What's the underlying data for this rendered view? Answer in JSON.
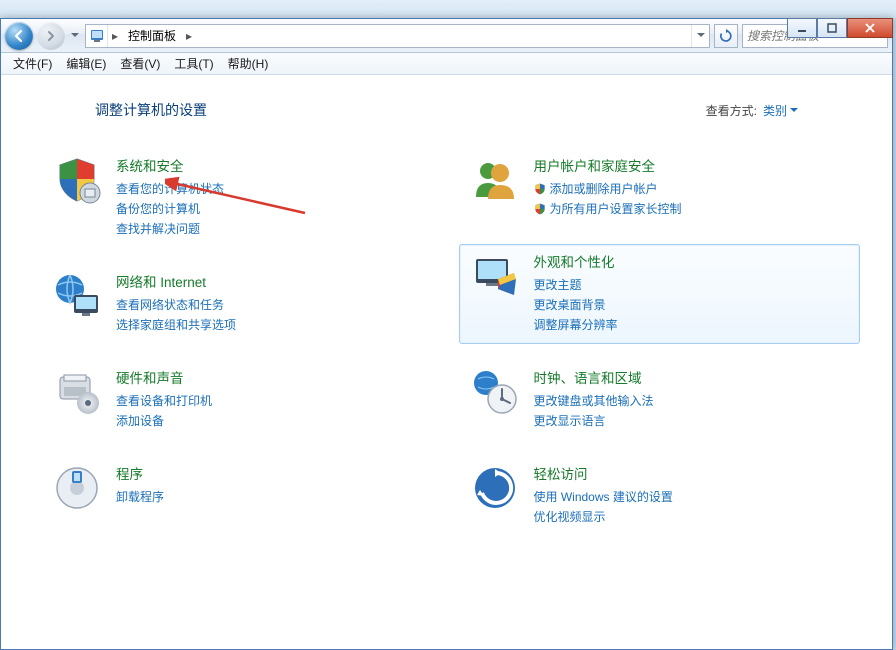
{
  "breadcrumb": {
    "label": "控制面板"
  },
  "search": {
    "placeholder": "搜索控制面板"
  },
  "menu": {
    "file": "文件(F)",
    "edit": "编辑(E)",
    "view": "查看(V)",
    "tools": "工具(T)",
    "help": "帮助(H)"
  },
  "header": {
    "title": "调整计算机的设置",
    "view_by_label": "查看方式:",
    "view_by_value": "类别"
  },
  "left": [
    {
      "heading": "系统和安全",
      "links": [
        "查看您的计算机状态",
        "备份您的计算机",
        "查找并解决问题"
      ]
    },
    {
      "heading": "网络和 Internet",
      "links": [
        "查看网络状态和任务",
        "选择家庭组和共享选项"
      ]
    },
    {
      "heading": "硬件和声音",
      "links": [
        "查看设备和打印机",
        "添加设备"
      ]
    },
    {
      "heading": "程序",
      "links": [
        "卸载程序"
      ]
    }
  ],
  "right": [
    {
      "heading": "用户帐户和家庭安全",
      "links": [
        {
          "text": "添加或删除用户帐户",
          "shield": true
        },
        {
          "text": "为所有用户设置家长控制",
          "shield": true
        }
      ]
    },
    {
      "heading": "外观和个性化",
      "links": [
        {
          "text": "更改主题"
        },
        {
          "text": "更改桌面背景"
        },
        {
          "text": "调整屏幕分辨率"
        }
      ],
      "selected": true
    },
    {
      "heading": "时钟、语言和区域",
      "links": [
        {
          "text": "更改键盘或其他输入法"
        },
        {
          "text": "更改显示语言"
        }
      ]
    },
    {
      "heading": "轻松访问",
      "links": [
        {
          "text": "使用 Windows 建议的设置"
        },
        {
          "text": "优化视频显示"
        }
      ]
    }
  ]
}
